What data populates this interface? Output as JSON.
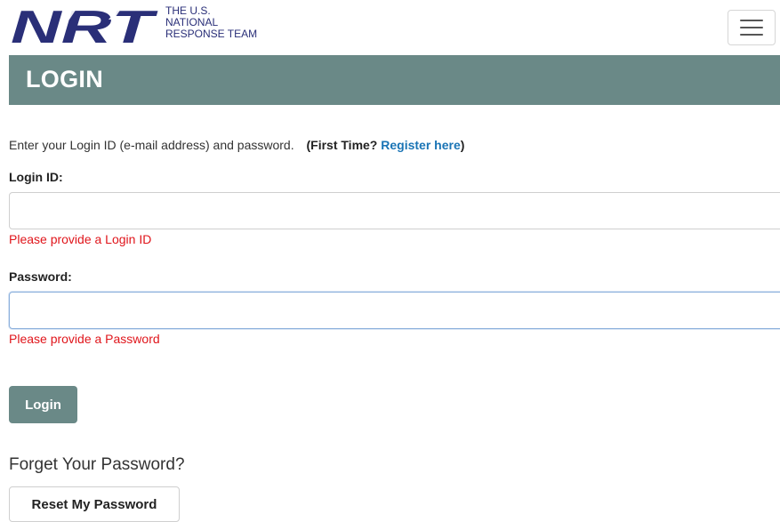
{
  "header": {
    "logo_text": "NRT",
    "org_name": [
      "THE U.S.",
      "NATIONAL",
      "RESPONSE TEAM"
    ],
    "menu_icon": "hamburger-menu-icon"
  },
  "page": {
    "title": "LOGIN",
    "intro_text": "Enter your Login ID (e-mail address) and password.",
    "first_time_prefix": "(First Time?",
    "register_link": "Register here",
    "first_time_suffix": ")"
  },
  "form": {
    "login_id_label": "Login ID:",
    "login_id_value": "",
    "login_id_error": "Please provide a Login ID",
    "password_label": "Password:",
    "password_value": "",
    "password_error": "Please provide a Password",
    "login_button": "Login"
  },
  "forgot": {
    "heading": "Forget Your Password?",
    "reset_button": "Reset My Password"
  },
  "colors": {
    "brand_bar": "#6a8987",
    "logo_navy": "#2a2f78",
    "link": "#1a74b5",
    "error": "#e0151b"
  }
}
